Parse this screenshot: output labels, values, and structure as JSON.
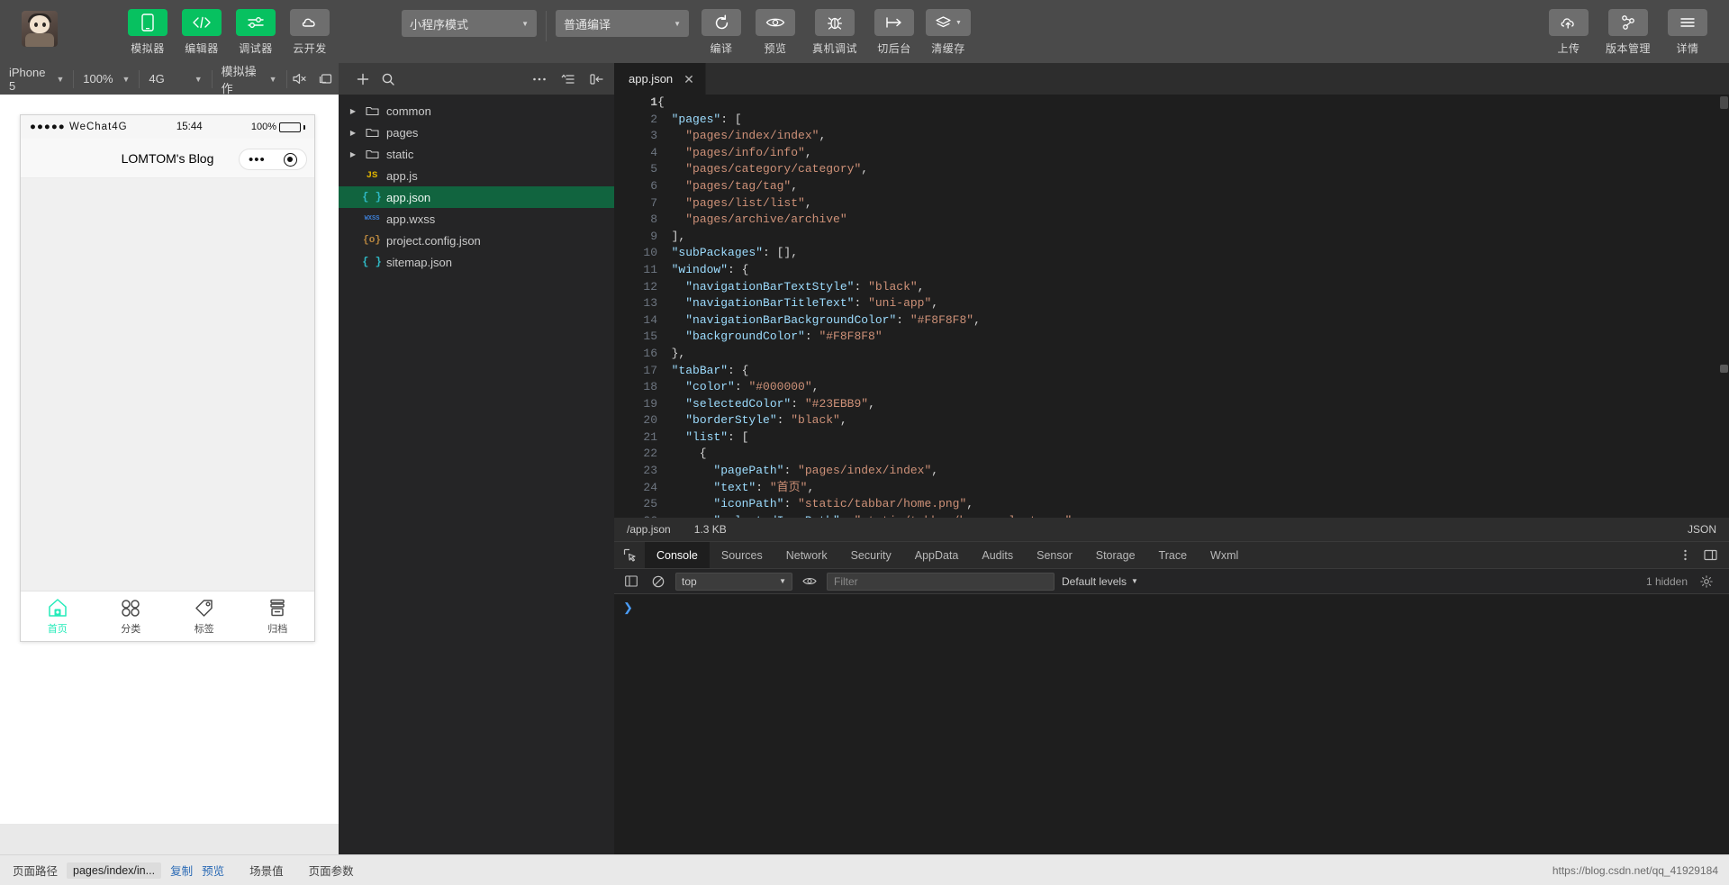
{
  "toolbar": {
    "avatar_name": "user-avatar",
    "buttons": [
      {
        "label": "模拟器",
        "icon": "phone-icon",
        "style": "green"
      },
      {
        "label": "编辑器",
        "icon": "code-icon",
        "style": "green"
      },
      {
        "label": "调试器",
        "icon": "sliders-icon",
        "style": "green"
      },
      {
        "label": "云开发",
        "icon": "cloud-dev-icon",
        "style": "grey"
      }
    ],
    "mode_select": "小程序模式",
    "compile_select": "普通编译",
    "actions": [
      {
        "label": "编译",
        "icon": "refresh-icon"
      },
      {
        "label": "预览",
        "icon": "eye-icon"
      },
      {
        "label": "真机调试",
        "icon": "bug-icon"
      },
      {
        "label": "切后台",
        "icon": "background-icon"
      },
      {
        "label": "清缓存",
        "icon": "layers-icon"
      }
    ],
    "right_actions": [
      {
        "label": "上传",
        "icon": "upload-cloud-icon"
      },
      {
        "label": "版本管理",
        "icon": "branch-icon"
      },
      {
        "label": "详情",
        "icon": "menu-icon"
      }
    ]
  },
  "simulator": {
    "device": "iPhone 5",
    "zoom": "100%",
    "network": "4G",
    "mock": "模拟操作",
    "icons": [
      "mute-icon",
      "rotate-screen-icon"
    ],
    "phone": {
      "carrier": "WeChat4G",
      "signal_dots": "●●●●●",
      "time": "15:44",
      "battery": "100%",
      "nav_title": "LOMTOM's Blog",
      "capsule_more": "•••",
      "tabs": [
        {
          "label": "首页",
          "icon": "home-icon",
          "active": true
        },
        {
          "label": "分类",
          "icon": "category-icon",
          "active": false
        },
        {
          "label": "标签",
          "icon": "tag-icon",
          "active": false
        },
        {
          "label": "归档",
          "icon": "archive-icon",
          "active": false
        }
      ]
    }
  },
  "filetree": {
    "toolbar_icons": [
      "more-icon",
      "collapse-all-icon",
      "toggle-sidebar-icon"
    ],
    "items": [
      {
        "name": "common",
        "type": "folder",
        "icon": "folder-icon",
        "expandable": true,
        "selected": false
      },
      {
        "name": "pages",
        "type": "folder",
        "icon": "folder-icon",
        "expandable": true,
        "selected": false
      },
      {
        "name": "static",
        "type": "folder",
        "icon": "folder-icon",
        "expandable": true,
        "selected": false
      },
      {
        "name": "app.js",
        "type": "js",
        "icon": "js-file-icon",
        "expandable": false,
        "selected": false
      },
      {
        "name": "app.json",
        "type": "json",
        "icon": "json-file-icon",
        "expandable": false,
        "selected": true
      },
      {
        "name": "app.wxss",
        "type": "wxss",
        "icon": "wxss-file-icon",
        "expandable": false,
        "selected": false
      },
      {
        "name": "project.config.json",
        "type": "config",
        "icon": "config-file-icon",
        "expandable": false,
        "selected": false
      },
      {
        "name": "sitemap.json",
        "type": "json",
        "icon": "json-file-icon",
        "expandable": false,
        "selected": false
      }
    ]
  },
  "editor": {
    "tab_title": "app.json",
    "close_label": "✕",
    "status_path": "/app.json",
    "status_size": "1.3 KB",
    "status_lang": "JSON",
    "lines": [
      {
        "n": "1",
        "tokens": [
          {
            "t": "{",
            "c": "p"
          }
        ]
      },
      {
        "n": "2",
        "tokens": [
          {
            "t": "  ",
            "c": "p"
          },
          {
            "t": "\"pages\"",
            "c": "k"
          },
          {
            "t": ": [",
            "c": "p"
          }
        ]
      },
      {
        "n": "3",
        "tokens": [
          {
            "t": "    ",
            "c": "p"
          },
          {
            "t": "\"pages/index/index\"",
            "c": "s"
          },
          {
            "t": ",",
            "c": "p"
          }
        ]
      },
      {
        "n": "4",
        "tokens": [
          {
            "t": "    ",
            "c": "p"
          },
          {
            "t": "\"pages/info/info\"",
            "c": "s"
          },
          {
            "t": ",",
            "c": "p"
          }
        ]
      },
      {
        "n": "5",
        "tokens": [
          {
            "t": "    ",
            "c": "p"
          },
          {
            "t": "\"pages/category/category\"",
            "c": "s"
          },
          {
            "t": ",",
            "c": "p"
          }
        ]
      },
      {
        "n": "6",
        "tokens": [
          {
            "t": "    ",
            "c": "p"
          },
          {
            "t": "\"pages/tag/tag\"",
            "c": "s"
          },
          {
            "t": ",",
            "c": "p"
          }
        ]
      },
      {
        "n": "7",
        "tokens": [
          {
            "t": "    ",
            "c": "p"
          },
          {
            "t": "\"pages/list/list\"",
            "c": "s"
          },
          {
            "t": ",",
            "c": "p"
          }
        ]
      },
      {
        "n": "8",
        "tokens": [
          {
            "t": "    ",
            "c": "p"
          },
          {
            "t": "\"pages/archive/archive\"",
            "c": "s"
          }
        ]
      },
      {
        "n": "9",
        "tokens": [
          {
            "t": "  ],",
            "c": "p"
          }
        ]
      },
      {
        "n": "10",
        "tokens": [
          {
            "t": "  ",
            "c": "p"
          },
          {
            "t": "\"subPackages\"",
            "c": "k"
          },
          {
            "t": ": [],",
            "c": "p"
          }
        ]
      },
      {
        "n": "11",
        "tokens": [
          {
            "t": "  ",
            "c": "p"
          },
          {
            "t": "\"window\"",
            "c": "k"
          },
          {
            "t": ": {",
            "c": "p"
          }
        ]
      },
      {
        "n": "12",
        "tokens": [
          {
            "t": "    ",
            "c": "p"
          },
          {
            "t": "\"navigationBarTextStyle\"",
            "c": "k"
          },
          {
            "t": ": ",
            "c": "p"
          },
          {
            "t": "\"black\"",
            "c": "s"
          },
          {
            "t": ",",
            "c": "p"
          }
        ]
      },
      {
        "n": "13",
        "tokens": [
          {
            "t": "    ",
            "c": "p"
          },
          {
            "t": "\"navigationBarTitleText\"",
            "c": "k"
          },
          {
            "t": ": ",
            "c": "p"
          },
          {
            "t": "\"uni-app\"",
            "c": "s"
          },
          {
            "t": ",",
            "c": "p"
          }
        ]
      },
      {
        "n": "14",
        "tokens": [
          {
            "t": "    ",
            "c": "p"
          },
          {
            "t": "\"navigationBarBackgroundColor\"",
            "c": "k"
          },
          {
            "t": ": ",
            "c": "p"
          },
          {
            "t": "\"#F8F8F8\"",
            "c": "s"
          },
          {
            "t": ",",
            "c": "p"
          }
        ]
      },
      {
        "n": "15",
        "tokens": [
          {
            "t": "    ",
            "c": "p"
          },
          {
            "t": "\"backgroundColor\"",
            "c": "k"
          },
          {
            "t": ": ",
            "c": "p"
          },
          {
            "t": "\"#F8F8F8\"",
            "c": "s"
          }
        ]
      },
      {
        "n": "16",
        "tokens": [
          {
            "t": "  },",
            "c": "p"
          }
        ]
      },
      {
        "n": "17",
        "tokens": [
          {
            "t": "  ",
            "c": "p"
          },
          {
            "t": "\"tabBar\"",
            "c": "k"
          },
          {
            "t": ": {",
            "c": "p"
          }
        ]
      },
      {
        "n": "18",
        "tokens": [
          {
            "t": "    ",
            "c": "p"
          },
          {
            "t": "\"color\"",
            "c": "k"
          },
          {
            "t": ": ",
            "c": "p"
          },
          {
            "t": "\"#000000\"",
            "c": "s"
          },
          {
            "t": ",",
            "c": "p"
          }
        ]
      },
      {
        "n": "19",
        "tokens": [
          {
            "t": "    ",
            "c": "p"
          },
          {
            "t": "\"selectedColor\"",
            "c": "k"
          },
          {
            "t": ": ",
            "c": "p"
          },
          {
            "t": "\"#23EBB9\"",
            "c": "s"
          },
          {
            "t": ",",
            "c": "p"
          }
        ]
      },
      {
        "n": "20",
        "tokens": [
          {
            "t": "    ",
            "c": "p"
          },
          {
            "t": "\"borderStyle\"",
            "c": "k"
          },
          {
            "t": ": ",
            "c": "p"
          },
          {
            "t": "\"black\"",
            "c": "s"
          },
          {
            "t": ",",
            "c": "p"
          }
        ]
      },
      {
        "n": "21",
        "tokens": [
          {
            "t": "    ",
            "c": "p"
          },
          {
            "t": "\"list\"",
            "c": "k"
          },
          {
            "t": ": [",
            "c": "p"
          }
        ]
      },
      {
        "n": "22",
        "tokens": [
          {
            "t": "      {",
            "c": "p"
          }
        ]
      },
      {
        "n": "23",
        "tokens": [
          {
            "t": "        ",
            "c": "p"
          },
          {
            "t": "\"pagePath\"",
            "c": "k"
          },
          {
            "t": ": ",
            "c": "p"
          },
          {
            "t": "\"pages/index/index\"",
            "c": "s"
          },
          {
            "t": ",",
            "c": "p"
          }
        ]
      },
      {
        "n": "24",
        "tokens": [
          {
            "t": "        ",
            "c": "p"
          },
          {
            "t": "\"text\"",
            "c": "k"
          },
          {
            "t": ": ",
            "c": "p"
          },
          {
            "t": "\"首页\"",
            "c": "s"
          },
          {
            "t": ",",
            "c": "p"
          }
        ]
      },
      {
        "n": "25",
        "tokens": [
          {
            "t": "        ",
            "c": "p"
          },
          {
            "t": "\"iconPath\"",
            "c": "k"
          },
          {
            "t": ": ",
            "c": "p"
          },
          {
            "t": "\"static/tabbar/home.png\"",
            "c": "s"
          },
          {
            "t": ",",
            "c": "p"
          }
        ]
      },
      {
        "n": "26",
        "tokens": [
          {
            "t": "        ",
            "c": "p"
          },
          {
            "t": "\"selectedIconPath\"",
            "c": "k"
          },
          {
            "t": ": ",
            "c": "p"
          },
          {
            "t": "\"static/tabbar/home-select.png\"",
            "c": "s"
          }
        ]
      }
    ]
  },
  "console": {
    "tabs": [
      {
        "label": "Console",
        "active": true
      },
      {
        "label": "Sources",
        "active": false
      },
      {
        "label": "Network",
        "active": false
      },
      {
        "label": "Security",
        "active": false
      },
      {
        "label": "AppData",
        "active": false
      },
      {
        "label": "Audits",
        "active": false
      },
      {
        "label": "Sensor",
        "active": false
      },
      {
        "label": "Storage",
        "active": false
      },
      {
        "label": "Trace",
        "active": false
      },
      {
        "label": "Wxml",
        "active": false
      }
    ],
    "context": "top",
    "filter_placeholder": "Filter",
    "levels": "Default levels",
    "hidden_count": "1 hidden",
    "prompt": "❯"
  },
  "bottom": {
    "path_label": "页面路径",
    "path_value": "pages/index/in...",
    "copy_label": "复制",
    "preview_label": "预览",
    "scene_label": "场景值",
    "params_label": "页面参数",
    "watermark": "https://blog.csdn.net/qq_41929184"
  },
  "colors": {
    "accent_green": "#07c160",
    "tab_selected": "#23EBB9",
    "toolbar_bg": "#4a4a4a",
    "editor_bg": "#1e1e1e",
    "tree_bg": "#252526",
    "selection_green": "#11643f"
  }
}
